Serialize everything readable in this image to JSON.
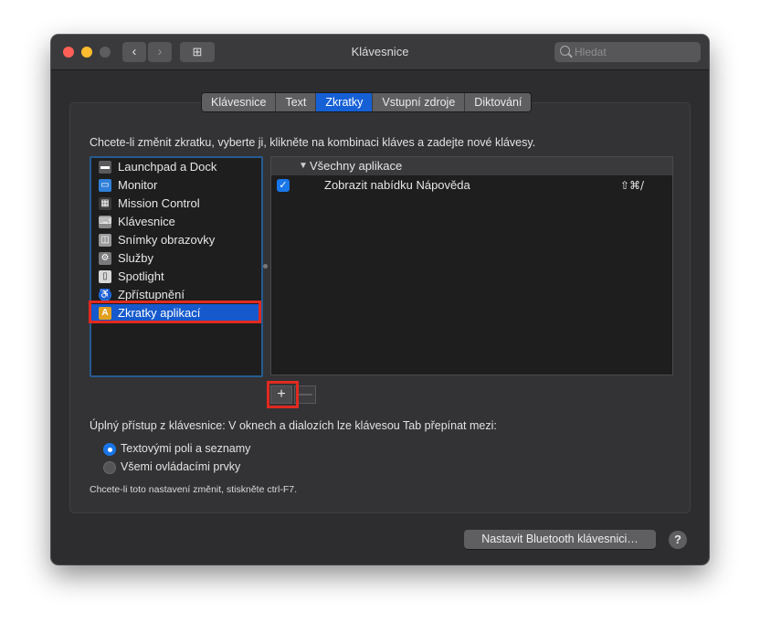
{
  "window": {
    "title": "Klávesnice",
    "back_glyph": "‹",
    "forward_glyph": "›",
    "grid_glyph": "⊞",
    "search_placeholder": "Hledat"
  },
  "tabs": [
    {
      "label": "Klávesnice",
      "active": false
    },
    {
      "label": "Text",
      "active": false
    },
    {
      "label": "Zkratky",
      "active": true
    },
    {
      "label": "Vstupní zdroje",
      "active": false
    },
    {
      "label": "Diktování",
      "active": false
    }
  ],
  "instructions": "Chcete-li změnit zkratku, vyberte ji, klikněte na kombinaci kláves a zadejte nové klávesy.",
  "categories": [
    {
      "label": "Launchpad a Dock",
      "icon": "launchpad-icon",
      "glyph": "▬",
      "color": "#5a5a5e"
    },
    {
      "label": "Monitor",
      "icon": "monitor-icon",
      "glyph": "▭",
      "color": "#2f7fd8"
    },
    {
      "label": "Mission Control",
      "icon": "mission-control-icon",
      "glyph": "▦",
      "color": "#3b3b3b"
    },
    {
      "label": "Klávesnice",
      "icon": "keyboard-icon",
      "glyph": "⌨",
      "color": "#8a8a8c"
    },
    {
      "label": "Snímky obrazovky",
      "icon": "screenshot-icon",
      "glyph": "◫",
      "color": "#9a9a9c"
    },
    {
      "label": "Služby",
      "icon": "gear-icon",
      "glyph": "⚙",
      "color": "#7a7a7c"
    },
    {
      "label": "Spotlight",
      "icon": "spotlight-icon",
      "glyph": "▯",
      "color": "#d8d8d8"
    },
    {
      "label": "Zpřístupnění",
      "icon": "accessibility-icon",
      "glyph": "♿",
      "color": "#1f6fe0"
    },
    {
      "label": "Zkratky aplikací",
      "icon": "app-shortcuts-icon",
      "glyph": "A",
      "color": "#e2a020",
      "selected": true
    }
  ],
  "shortcuts": {
    "group_label": "Všechny aplikace",
    "disclosure_glyph": "▼",
    "items": [
      {
        "label": "Zobrazit nabídku Nápověda",
        "keys": "⇧⌘/",
        "checked": true
      }
    ]
  },
  "buttons": {
    "add": "+",
    "remove": "—"
  },
  "access": {
    "label": "Úplný přístup z klávesnice: V oknech a dialozích lze klávesou Tab přepínat mezi:",
    "options": [
      {
        "label": "Textovými poli a seznamy",
        "selected": true
      },
      {
        "label": "Všemi ovládacími prvky",
        "selected": false
      }
    ],
    "hint": "Chcete-li toto nastavení změnit, stiskněte ctrl-F7."
  },
  "footer": {
    "bluetooth_button": "Nastavit Bluetooth klávesnici…",
    "help": "?"
  },
  "colors": {
    "accent": "#1660d6",
    "highlight_annotation": "#e12a1f"
  }
}
